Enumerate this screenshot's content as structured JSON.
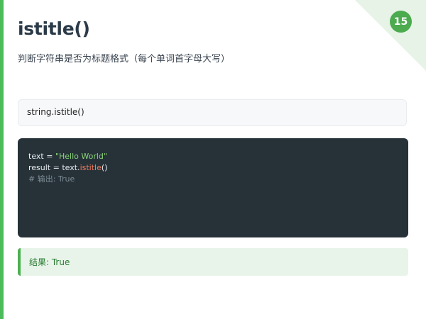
{
  "slide": {
    "page_number": "15",
    "title": "istitle()",
    "subtitle": "判断字符串是否为标题格式（每个单词首字母大写）"
  },
  "syntax": {
    "text": "string.istitle()"
  },
  "code": {
    "line1": {
      "var": "text",
      "op": " = ",
      "string": "\"Hello World\""
    },
    "line2": {
      "var": "result",
      "op": " = ",
      "obj": "text.",
      "method": "istitle",
      "parens": "()"
    },
    "line3": {
      "comment": "# 输出: True"
    }
  },
  "result": {
    "text": "结果: True"
  },
  "colors": {
    "accent_green": "#4caf50",
    "code_background": "#263238",
    "string_color": "#8bd47a",
    "method_color": "#f77a5c",
    "comment_color": "#7f8c95",
    "title_color": "#2b3a48"
  }
}
